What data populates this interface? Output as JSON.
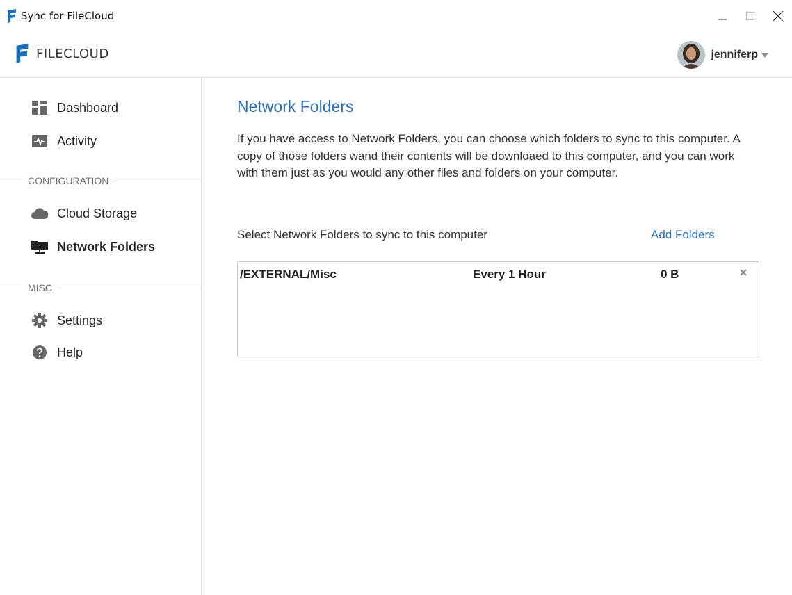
{
  "window": {
    "title": "Sync for FileCloud"
  },
  "header": {
    "brand": "FILECLOUD",
    "username": "jenniferp"
  },
  "sidebar": {
    "items": [
      {
        "label": "Dashboard",
        "icon": "dashboard-icon"
      },
      {
        "label": "Activity",
        "icon": "activity-icon"
      },
      {
        "label": "Cloud Storage",
        "icon": "cloud-icon"
      },
      {
        "label": "Network Folders",
        "icon": "network-folder-icon",
        "active": true
      },
      {
        "label": "Settings",
        "icon": "gear-icon"
      },
      {
        "label": "Help",
        "icon": "help-icon"
      }
    ],
    "sections": {
      "configuration": "CONFIGURATION",
      "misc": "MISC"
    }
  },
  "main": {
    "title": "Network Folders",
    "description": "If you have access to Network Folders, you can choose which folders to sync to this computer. A copy of those folders wand their contents will be downloaed to this computer, and you can work with them just as you would any other files and folders on your computer.",
    "select_label": "Select Network Folders to sync to this computer",
    "add_folders": "Add Folders",
    "folders": [
      {
        "path": "/EXTERNAL/Misc",
        "frequency": "Every 1 Hour",
        "size": "0 B"
      }
    ]
  },
  "colors": {
    "accent": "#2a6fb5",
    "brand_blue": "#1d6fb8",
    "text": "#333333",
    "border": "#c8c8c8"
  }
}
